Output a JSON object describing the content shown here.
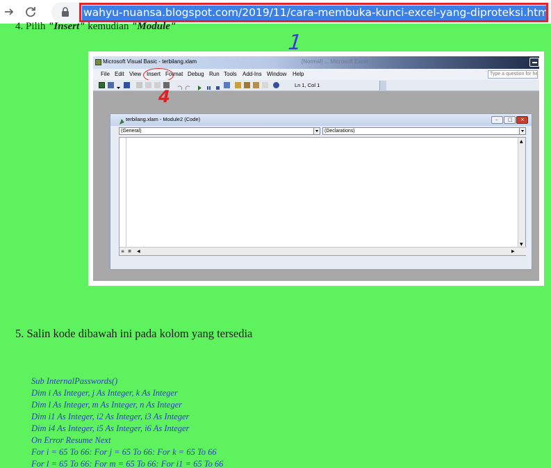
{
  "browser": {
    "back_icon": "arrow-right-icon",
    "reload_icon": "reload-icon",
    "lock_icon": "lock-icon",
    "url": "wahyu-nuansa.blogspot.com/2019/11/cara-membuka-kunci-excel-yang-diproteksi.html"
  },
  "article": {
    "step4_partial": "4. Pilih ",
    "step4_insert": "\"Insert\"",
    "step4_mid": " kemudian ",
    "step4_module": "\"Module\"",
    "annotation_1": "1",
    "annotation_4": "4",
    "step5": "5. Salin kode dibawah ini pada kolom yang tersedia",
    "code_lines": [
      "Sub InternalPasswords()",
      "Dim i As Integer, j As Integer, k As Integer",
      "Dim l As Integer, m As Integer, n As Integer",
      "Dim i1 As Integer, i2 As Integer, i3 As Integer",
      "Dim i4 As Integer, i5 As Integer, i6 As Integer",
      "On Error Resume Next",
      "For i = 65 To 66: For j = 65 To 66: For k = 65 To 66",
      "For l = 65 To 66: For m = 65 To 66: For i1 = 65 To 66"
    ]
  },
  "vbe": {
    "title": "Microsoft Visual Basic - terbilang.xlam",
    "title_ghost": "[Normal]  ...  Microsoft Excel",
    "menu": [
      "File",
      "Edit",
      "View",
      "Insert",
      "Format",
      "Debug",
      "Run",
      "Tools",
      "Add-Ins",
      "Window",
      "Help"
    ],
    "help_placeholder": "Type a question for help",
    "position": "Ln 1, Col 1",
    "code_window": {
      "title": "terbilang.xlam - Module2 (Code)",
      "object_combo": "(General)",
      "proc_combo": "(Declarations)"
    }
  },
  "colors": {
    "page_bg": "#5ef35e",
    "url_highlight": "#3a80e8",
    "annotation_red": "#e02020",
    "annotation_blue": "#3b3bd8",
    "code_text": "#2e3ec0"
  }
}
